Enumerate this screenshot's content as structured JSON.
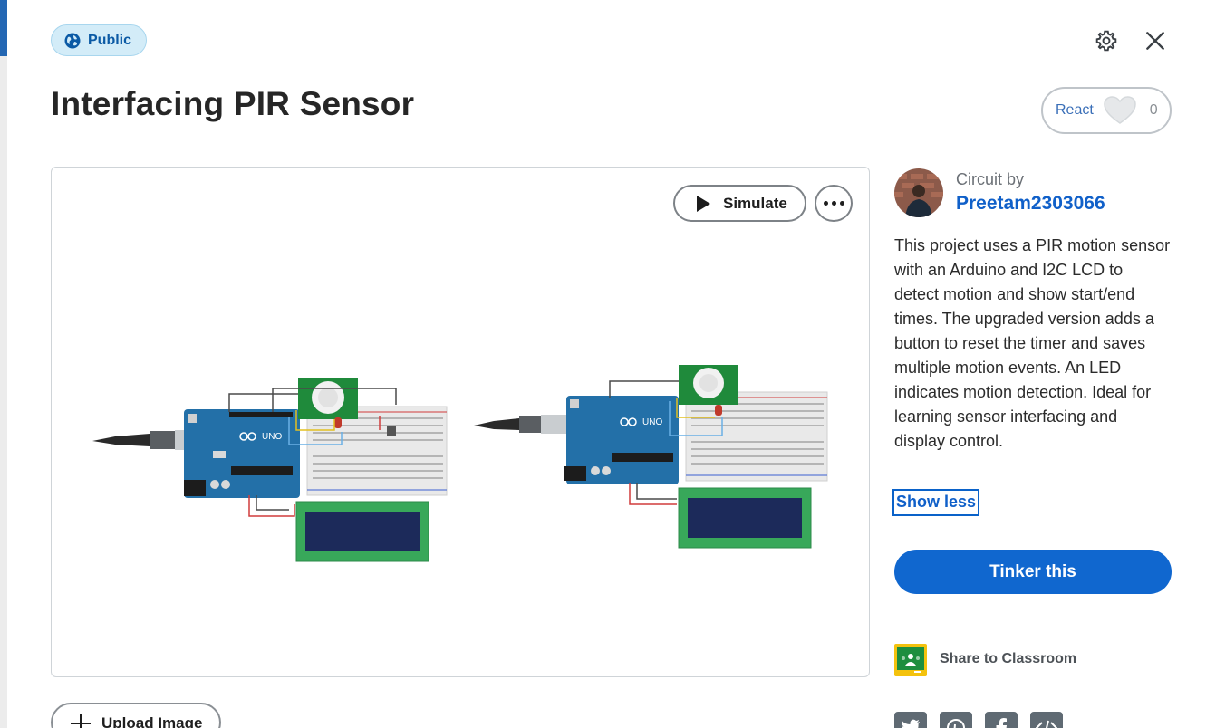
{
  "visibility_badge": {
    "label": "Public",
    "icon": "globe-icon",
    "color": "#0b5aa5"
  },
  "header": {
    "title": "Interfacing PIR Sensor",
    "settings_icon": "gear-icon",
    "close_icon": "close-icon"
  },
  "react": {
    "label": "React",
    "count": "0",
    "icon": "heart-icon"
  },
  "viewer": {
    "simulate_label": "Simulate",
    "more_icon": "more-options-icon",
    "circuit_labels": {
      "board_left": "UNO",
      "board_right": "UNO"
    }
  },
  "upload": {
    "label": "Upload Image"
  },
  "author": {
    "prefix": "Circuit by",
    "name": "Preetam2303066"
  },
  "description": "This project uses a PIR motion sensor with an Arduino and I2C LCD to detect motion and show start/end times. The upgraded version adds a button to reset the timer and saves multiple motion events. An LED indicates motion detection. Ideal for learning sensor interfacing and display control.",
  "show_less_label": "Show less",
  "tinker_label": "Tinker this",
  "share": {
    "classroom_label": "Share to Classroom"
  },
  "social_icons": [
    "twitter-icon",
    "pinterest-icon",
    "facebook-icon",
    "embed-icon"
  ],
  "colors": {
    "accent": "#1067cf",
    "link": "#1060c9",
    "badge_bg": "#d3ecf8"
  }
}
